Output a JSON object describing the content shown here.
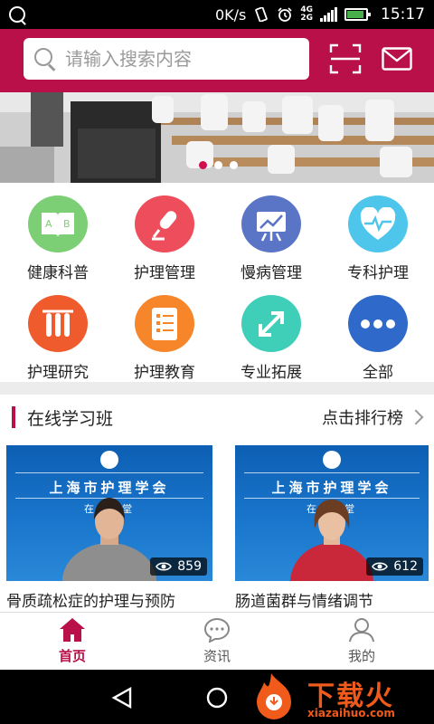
{
  "status_bar": {
    "speed": "0K/s",
    "network": [
      "4G",
      "2G"
    ],
    "time": "15:17",
    "icons": [
      "q-icon",
      "vibrate-icon",
      "alarm-icon",
      "signal-icon",
      "battery-icon"
    ]
  },
  "header": {
    "search_placeholder": "请输入搜索内容",
    "icons": [
      "search-icon",
      "scan-icon",
      "mail-icon"
    ],
    "accent": "#b9104a"
  },
  "banner": {
    "slide_count": 3,
    "active_index": 0
  },
  "categories": [
    {
      "label": "健康科普",
      "icon": "book-icon",
      "color": "#7ccf74"
    },
    {
      "label": "护理管理",
      "icon": "microphone-icon",
      "color": "#ee4e5b"
    },
    {
      "label": "慢病管理",
      "icon": "chart-board-icon",
      "color": "#5a74c6"
    },
    {
      "label": "专科护理",
      "icon": "heart-pulse-icon",
      "color": "#4ec5ea"
    },
    {
      "label": "护理研究",
      "icon": "test-tubes-icon",
      "color": "#ef5b2c"
    },
    {
      "label": "护理教育",
      "icon": "document-list-icon",
      "color": "#f7852a"
    },
    {
      "label": "专业拓展",
      "icon": "expand-arrows-icon",
      "color": "#3fcfb8"
    },
    {
      "label": "全部",
      "icon": "more-icon",
      "color": "#2f69c9"
    }
  ],
  "section": {
    "title": "在线学习班",
    "link_label": "点击排行榜"
  },
  "courses": [
    {
      "title": "骨质疏松症的护理与预防",
      "views": "859",
      "org": "上海市护理学会",
      "sub": "在线课堂"
    },
    {
      "title": "肠道菌群与情绪调节",
      "views": "612",
      "org": "上海市护理学会",
      "sub": "在线课堂"
    }
  ],
  "bottom_nav": [
    {
      "label": "首页",
      "icon": "home-icon",
      "active": true
    },
    {
      "label": "资讯",
      "icon": "chat-bubble-icon",
      "active": false
    },
    {
      "label": "我的",
      "icon": "user-icon",
      "active": false
    }
  ],
  "watermark": {
    "text": "下载火",
    "url": "xiazaihuo.com"
  }
}
